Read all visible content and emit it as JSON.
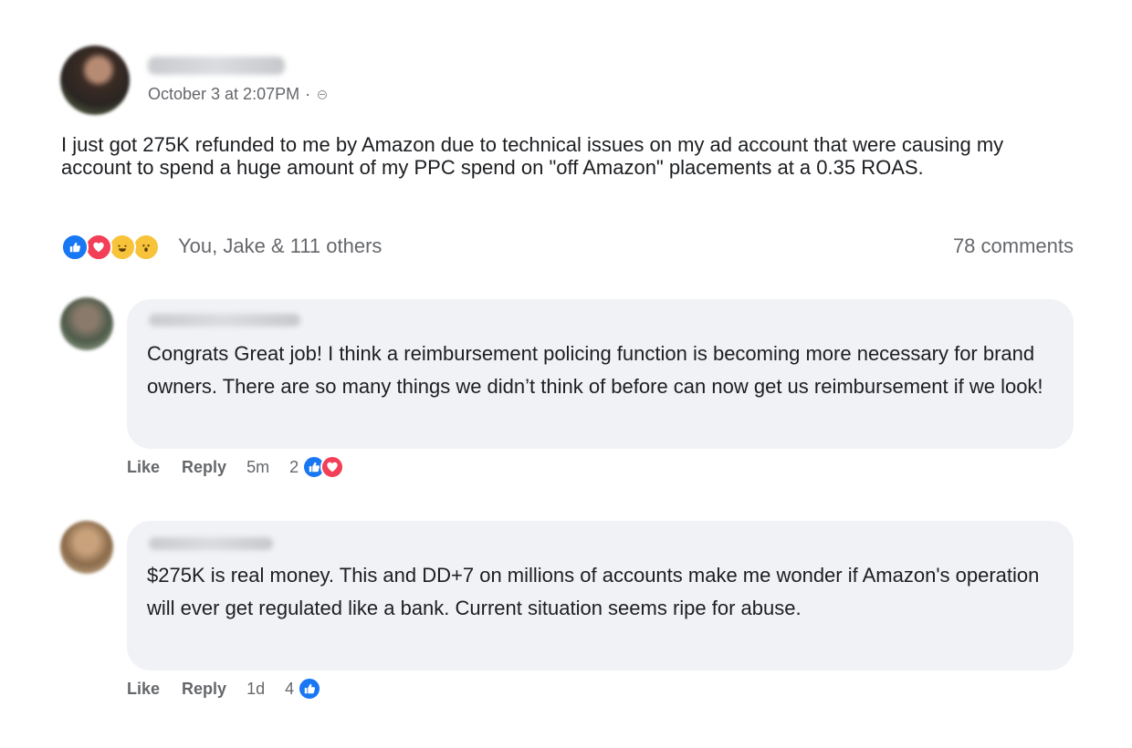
{
  "post": {
    "timestamp": "October 3 at 2:07PM",
    "separator": "·",
    "privacy_icon": "globe-icon",
    "text": "I just got 275K refunded to me by Amazon due to technical issues on my ad account that were causing my account to spend a huge amount of my PPC spend on \"off Amazon\" placements at a 0.35 ROAS.",
    "reactions": {
      "icons": [
        "like-icon",
        "love-icon",
        "haha-icon",
        "wow-icon"
      ],
      "summary": "You, Jake & 111 others"
    },
    "comments_count": "78 comments"
  },
  "comments": [
    {
      "text": "Congrats Great job! I think a reimbursement policing function is becoming more necessary for brand owners. There are so many things we didn’t think of before can now get us reimbursement if we look!",
      "like_label": "Like",
      "reply_label": "Reply",
      "time": "5m",
      "reaction_count": "2",
      "reaction_icons": [
        "like-icon",
        "love-icon"
      ]
    },
    {
      "text": "$275K is real money. This and DD+7 on millions of accounts make me wonder if Amazon's operation will ever get regulated like a bank. Current situation seems ripe for abuse.",
      "like_label": "Like",
      "reply_label": "Reply",
      "time": "1d",
      "reaction_count": "4",
      "reaction_icons": [
        "like-icon"
      ]
    }
  ],
  "colors": {
    "like": "#1877f2",
    "love": "#f33e58",
    "emoji": "#f7c33b",
    "secondary_text": "#65676b",
    "bubble": "#f0f2f5"
  }
}
